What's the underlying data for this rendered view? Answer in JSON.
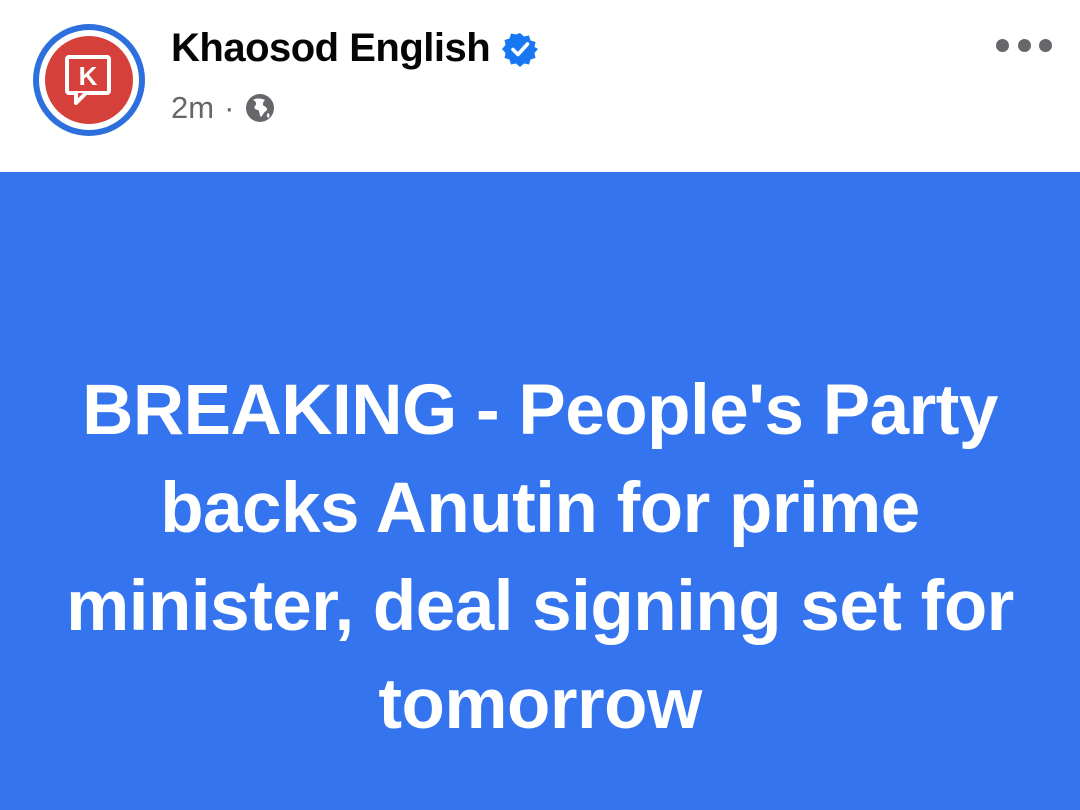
{
  "post": {
    "author": "Khaosod English",
    "verified": true,
    "time": "2m",
    "separator": "·",
    "audience_icon": "globe-icon",
    "menu_icon": "more-options-icon",
    "avatar_letter": "K"
  },
  "card": {
    "headline": "BREAKING - People's Party backs Anutin for prime minister, deal signing set for tomorrow"
  },
  "colors": {
    "card_background": "#3474ee",
    "avatar_ring": "#2d6fdc",
    "avatar_fill": "#d5403a",
    "verified_badge": "#1877f2",
    "meta_text": "#65676b"
  }
}
